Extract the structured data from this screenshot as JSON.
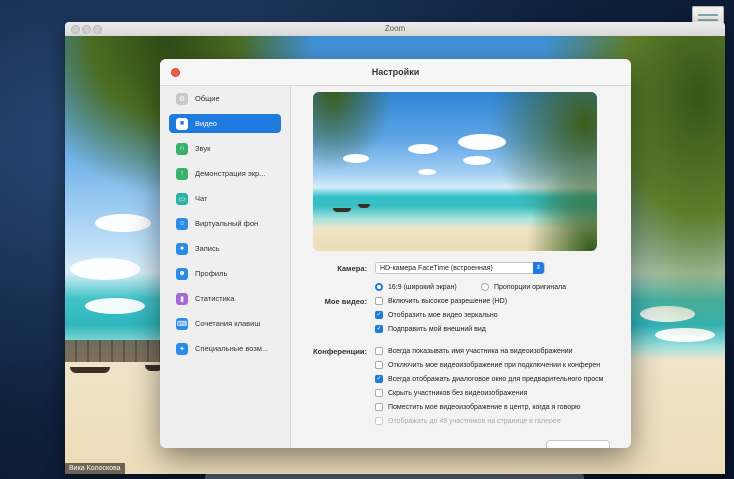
{
  "zoom_window": {
    "title": "Zoom",
    "user_name": "Вика Колоскова"
  },
  "settings": {
    "title": "Настройки",
    "sidebar": [
      {
        "label": "Общие",
        "icon": "gear-icon",
        "color": "#c8c8c8",
        "active": false
      },
      {
        "label": "Видео",
        "icon": "video-camera-icon",
        "color": "#1f7ae0",
        "active": true
      },
      {
        "label": "Звук",
        "icon": "headphones-icon",
        "color": "#38b26a",
        "active": false
      },
      {
        "label": "Демонстрация экр...",
        "icon": "screen-share-icon",
        "color": "#38b26a",
        "active": false
      },
      {
        "label": "Чат",
        "icon": "chat-icon",
        "color": "#2bb3a6",
        "active": false
      },
      {
        "label": "Виртуальный фон",
        "icon": "virtual-background-icon",
        "color": "#2a8be8",
        "active": false
      },
      {
        "label": "Запись",
        "icon": "record-icon",
        "color": "#2a8be8",
        "active": false
      },
      {
        "label": "Профиль",
        "icon": "profile-icon",
        "color": "#2a8be8",
        "active": false
      },
      {
        "label": "Статистика",
        "icon": "statistics-icon",
        "color": "#a768d8",
        "active": false
      },
      {
        "label": "Сочетания клавиш",
        "icon": "keyboard-icon",
        "color": "#2a8be8",
        "active": false
      },
      {
        "label": "Специальные возм...",
        "icon": "accessibility-icon",
        "color": "#2a8be8",
        "active": false
      }
    ],
    "video": {
      "camera_label": "Камера:",
      "camera_value": "HD-камера FaceTime (встроенная)",
      "ratio_options": [
        {
          "label": "16:9 (широкий экран)",
          "selected": true
        },
        {
          "label": "Пропорции оригинала",
          "selected": false
        }
      ],
      "my_video_label": "Мое видео:",
      "my_video_options": [
        {
          "label": "Включить высокое разрешение (HD)",
          "checked": false
        },
        {
          "label": "Отобразить мое видео зеркально",
          "checked": true
        },
        {
          "label": "Подправить мой внешний вид",
          "checked": true
        }
      ],
      "conference_label": "Конференции:",
      "conference_options": [
        {
          "label": "Всегда показывать имя участника на видеоизображении",
          "checked": false,
          "disabled": false
        },
        {
          "label": "Отключить мое видеоизображение при подключении к конферен",
          "checked": false,
          "disabled": false
        },
        {
          "label": "Всегда отображать диалоговое окно для предварительного просм",
          "checked": true,
          "disabled": false
        },
        {
          "label": "Скрыть участников без видеоизображения",
          "checked": false,
          "disabled": false
        },
        {
          "label": "Поместить мое видеоизображение в центр, когда я говорю",
          "checked": false,
          "disabled": false
        },
        {
          "label": "Отображать до 49 участников на странице в галерее",
          "checked": false,
          "disabled": true
        }
      ]
    }
  }
}
